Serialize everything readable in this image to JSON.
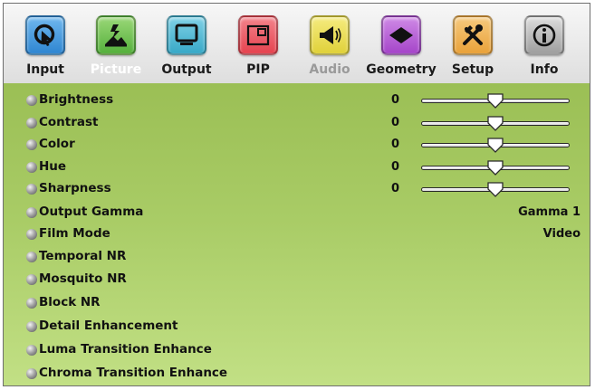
{
  "tabs": [
    {
      "label": "Input",
      "icon": "input-icon",
      "color": "#2f86d1"
    },
    {
      "label": "Picture",
      "icon": "picture-icon",
      "color": "#55b03c",
      "active": true
    },
    {
      "label": "Output",
      "icon": "output-icon",
      "color": "#38a9c7"
    },
    {
      "label": "PIP",
      "icon": "pip-icon",
      "color": "#e5434f"
    },
    {
      "label": "Audio",
      "icon": "audio-icon",
      "color": "#e0d13a",
      "muted": true
    },
    {
      "label": "Geometry",
      "icon": "geometry-icon",
      "color": "#a545c9"
    },
    {
      "label": "Setup",
      "icon": "setup-icon",
      "color": "#e9a23a"
    },
    {
      "label": "Info",
      "icon": "info-icon",
      "color": "#9e9e9e"
    }
  ],
  "picture_settings": [
    {
      "label": "Brightness",
      "value": "0",
      "slider": 0.5
    },
    {
      "label": "Contrast",
      "value": "0",
      "slider": 0.5
    },
    {
      "label": "Color",
      "value": "0",
      "slider": 0.5
    },
    {
      "label": "Hue",
      "value": "0",
      "slider": 0.5
    },
    {
      "label": "Sharpness",
      "value": "0",
      "slider": 0.5
    },
    {
      "label": "Output Gamma",
      "value": "Gamma 1"
    },
    {
      "label": "Film Mode",
      "value": "Video"
    },
    {
      "label": "Temporal NR"
    },
    {
      "label": "Mosquito NR"
    },
    {
      "label": "Block NR"
    },
    {
      "label": "Detail Enhancement"
    },
    {
      "label": "Luma Transition Enhance"
    },
    {
      "label": "Chroma Transition Enhance"
    }
  ],
  "colors": {
    "panel_green": "#a9cc66",
    "active_label": "#ffffff",
    "muted_label": "#9a9a9a"
  }
}
